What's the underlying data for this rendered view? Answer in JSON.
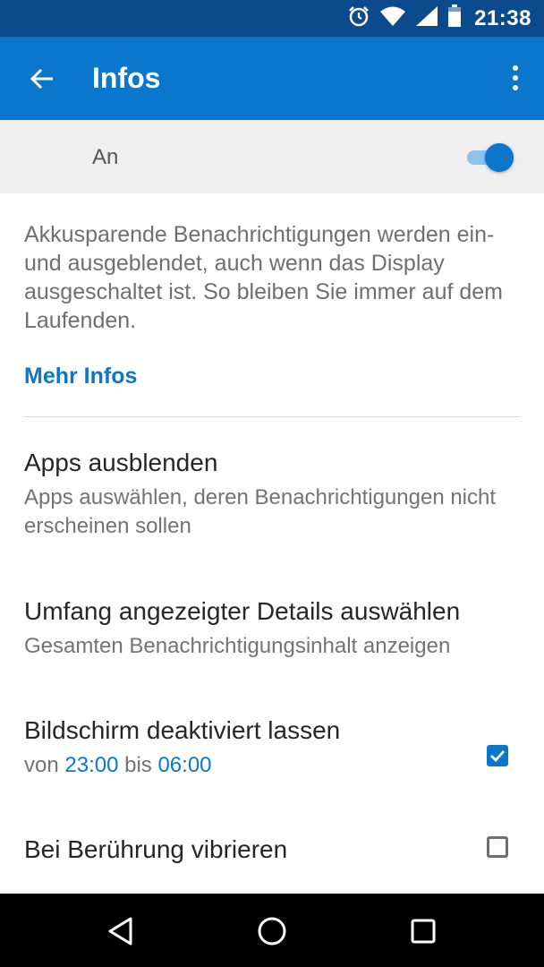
{
  "status_bar": {
    "time": "21:38",
    "icons": [
      "alarm-icon",
      "wifi-icon",
      "signal-icon",
      "battery-icon"
    ]
  },
  "app_bar": {
    "title": "Infos",
    "back_icon": "arrow-back-icon",
    "menu_icon": "more-vert-icon"
  },
  "master_switch": {
    "label": "An",
    "checked": true
  },
  "description": "Akkusparende Benachrichtigungen werden ein- und ausgeblendet, auch wenn das Display ausgeschaltet ist. So bleiben Sie immer auf dem Laufenden.",
  "more_info_link": "Mehr Infos",
  "preferences": [
    {
      "title": "Apps ausblenden",
      "summary": "Apps auswählen, deren Benachrichtigungen nicht erscheinen sollen"
    },
    {
      "title": "Umfang angezeigter Details auswählen",
      "summary": "Gesamten Benachrichtigungsinhalt anzeigen"
    },
    {
      "title": "Bildschirm deaktiviert lassen",
      "summary_prefix": "von ",
      "from_time": "23:00",
      "summary_middle": " bis ",
      "to_time": "06:00",
      "checked": true
    },
    {
      "title": "Bei Berührung vibrieren",
      "checked": false
    }
  ],
  "colors": {
    "status_bar": "#0b4a8c",
    "app_bar": "#0a77cd",
    "accent": "#0a77cd"
  }
}
